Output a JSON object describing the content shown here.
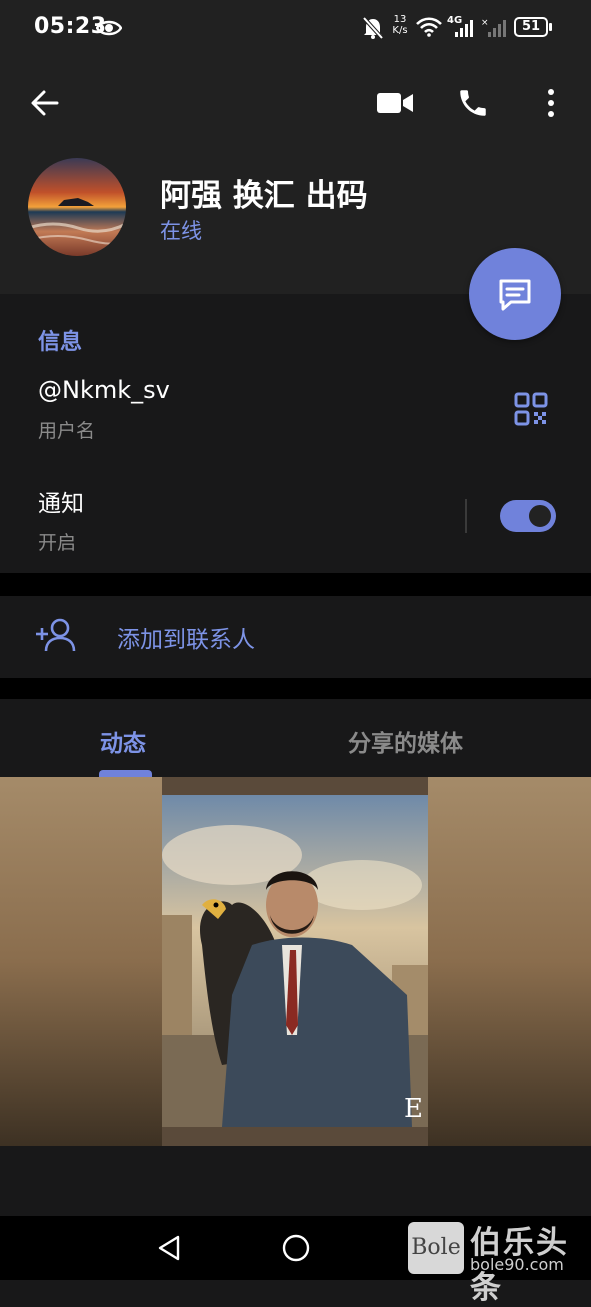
{
  "status_bar": {
    "time": "05:23",
    "net_rate_top": "13",
    "net_rate_bottom": "K/s",
    "network": "4G",
    "battery": "51"
  },
  "header": {
    "name": "阿强 换汇 出码",
    "status": "在线"
  },
  "icons": {
    "back": "arrow-left-icon",
    "video": "video-camera-icon",
    "phone": "phone-icon",
    "more": "more-vertical-icon",
    "message": "message-icon",
    "qr": "qr-code-icon",
    "add_contact": "add-person-icon"
  },
  "info": {
    "title": "信息",
    "username": "@Nkmk_sv",
    "username_label": "用户名",
    "notifications": "通知",
    "notifications_state": "开启",
    "notifications_on": true
  },
  "add_contact": {
    "label": "添加到联系人"
  },
  "tabs": [
    {
      "label": "动态",
      "active": true
    },
    {
      "label": "分享的媒体",
      "active": false
    }
  ],
  "watermark": {
    "box": "Bole",
    "cn": "伯乐头条",
    "url": "bole90.com"
  },
  "colors": {
    "accent": "#7082db",
    "accent_text": "#7d93e6",
    "bg": "#181819",
    "header_bg": "#212121"
  }
}
